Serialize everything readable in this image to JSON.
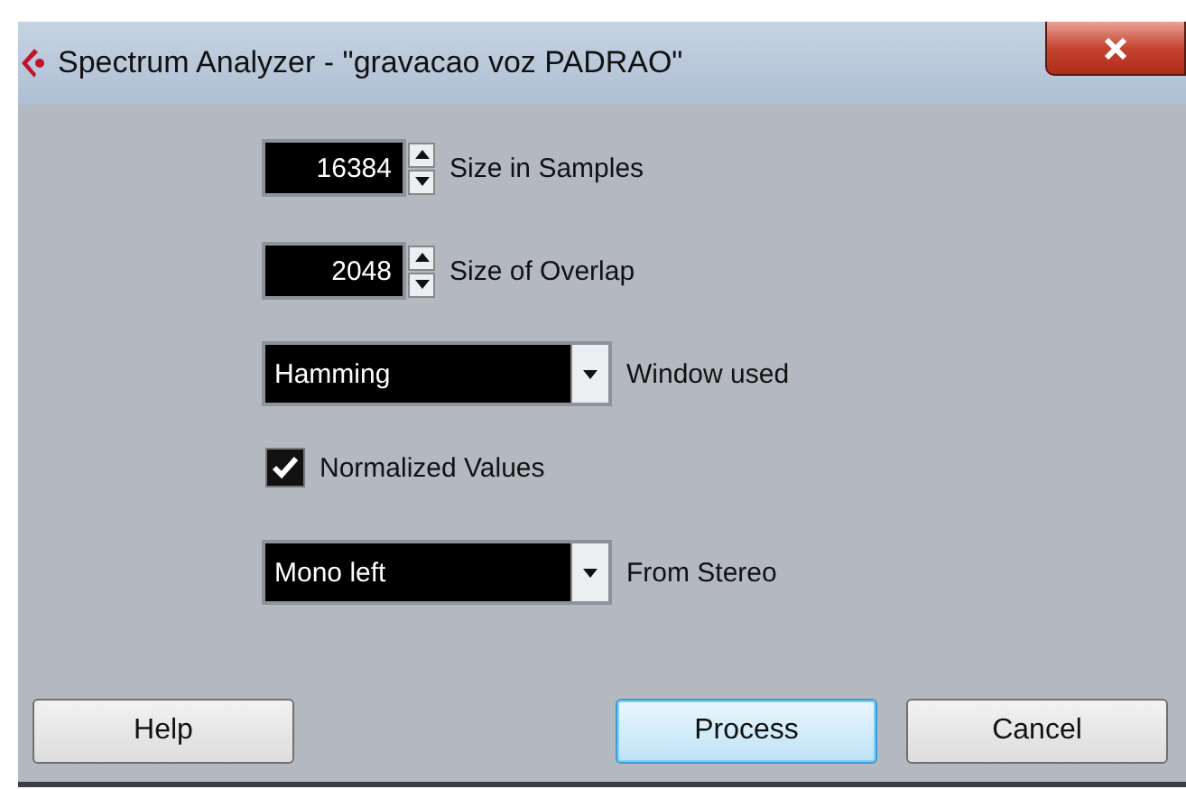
{
  "window": {
    "title": "Spectrum Analyzer - \"gravacao voz PADRAO\""
  },
  "settings": [
    {
      "kind": "spinbox",
      "value": "16384",
      "label": "Size in Samples"
    },
    {
      "kind": "spinbox",
      "value": "2048",
      "label": "Size of Overlap"
    },
    {
      "kind": "dropdown",
      "value": "Hamming",
      "label": "Window used"
    },
    {
      "kind": "checkbox",
      "checked": true,
      "label": "Normalized Values"
    },
    {
      "kind": "dropdown",
      "value": "Mono left",
      "label": "From Stereo"
    }
  ],
  "buttons": [
    {
      "label": "Help",
      "selected": false
    },
    {
      "label": "Process",
      "selected": true
    },
    {
      "label": "Cancel",
      "selected": false
    }
  ]
}
